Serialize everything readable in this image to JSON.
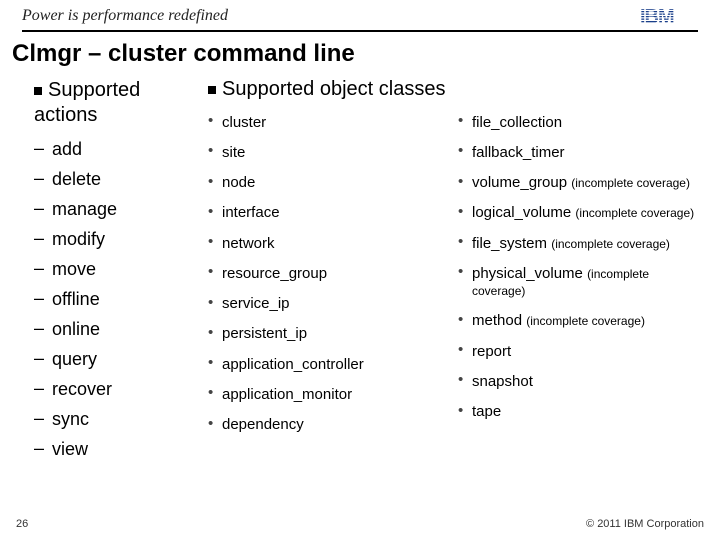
{
  "banner": {
    "tagline": "Power is performance redefined",
    "logo_letters": [
      "I",
      "B",
      "M"
    ]
  },
  "title": "Clmgr – cluster command line",
  "actions": {
    "heading": "Supported actions",
    "items": [
      "add",
      "delete",
      "manage",
      "modify",
      "move",
      "offline",
      "online",
      "query",
      "recover",
      "sync",
      "view"
    ]
  },
  "classes": {
    "heading": "Supported object classes",
    "col1": [
      {
        "name": "cluster"
      },
      {
        "name": "site"
      },
      {
        "name": "node"
      },
      {
        "name": "interface"
      },
      {
        "name": "network"
      },
      {
        "name": "resource_group"
      },
      {
        "name": "service_ip"
      },
      {
        "name": "persistent_ip"
      },
      {
        "name": "application_controller"
      },
      {
        "name": "application_monitor"
      },
      {
        "name": "dependency"
      }
    ],
    "col2": [
      {
        "name": "file_collection"
      },
      {
        "name": "fallback_timer"
      },
      {
        "name": "volume_group",
        "note": "(incomplete coverage)"
      },
      {
        "name": "logical_volume",
        "note": "(incomplete coverage)"
      },
      {
        "name": "file_system",
        "note": "(incomplete coverage)"
      },
      {
        "name": "physical_volume",
        "note": "(incomplete coverage)"
      },
      {
        "name": "method",
        "note": "(incomplete coverage)"
      },
      {
        "name": "report"
      },
      {
        "name": "snapshot"
      },
      {
        "name": "tape"
      }
    ]
  },
  "page_number": "26",
  "copyright": "© 2011 IBM Corporation"
}
